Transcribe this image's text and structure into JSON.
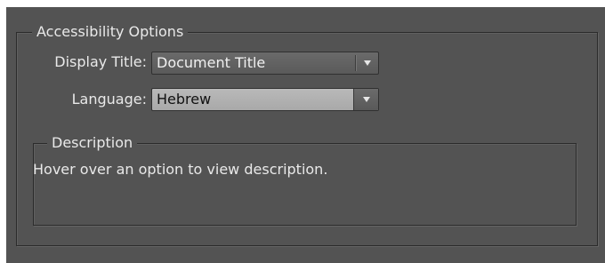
{
  "accessibility": {
    "group_title": "Accessibility Options",
    "display_title": {
      "label": "Display Title:",
      "value": "Document Title"
    },
    "language": {
      "label": "Language:",
      "value": "Hebrew"
    }
  },
  "description": {
    "group_title": "Description",
    "text": "Hover over an option to view description."
  },
  "icons": {
    "dropdown_arrow": "chevron-down-icon"
  }
}
